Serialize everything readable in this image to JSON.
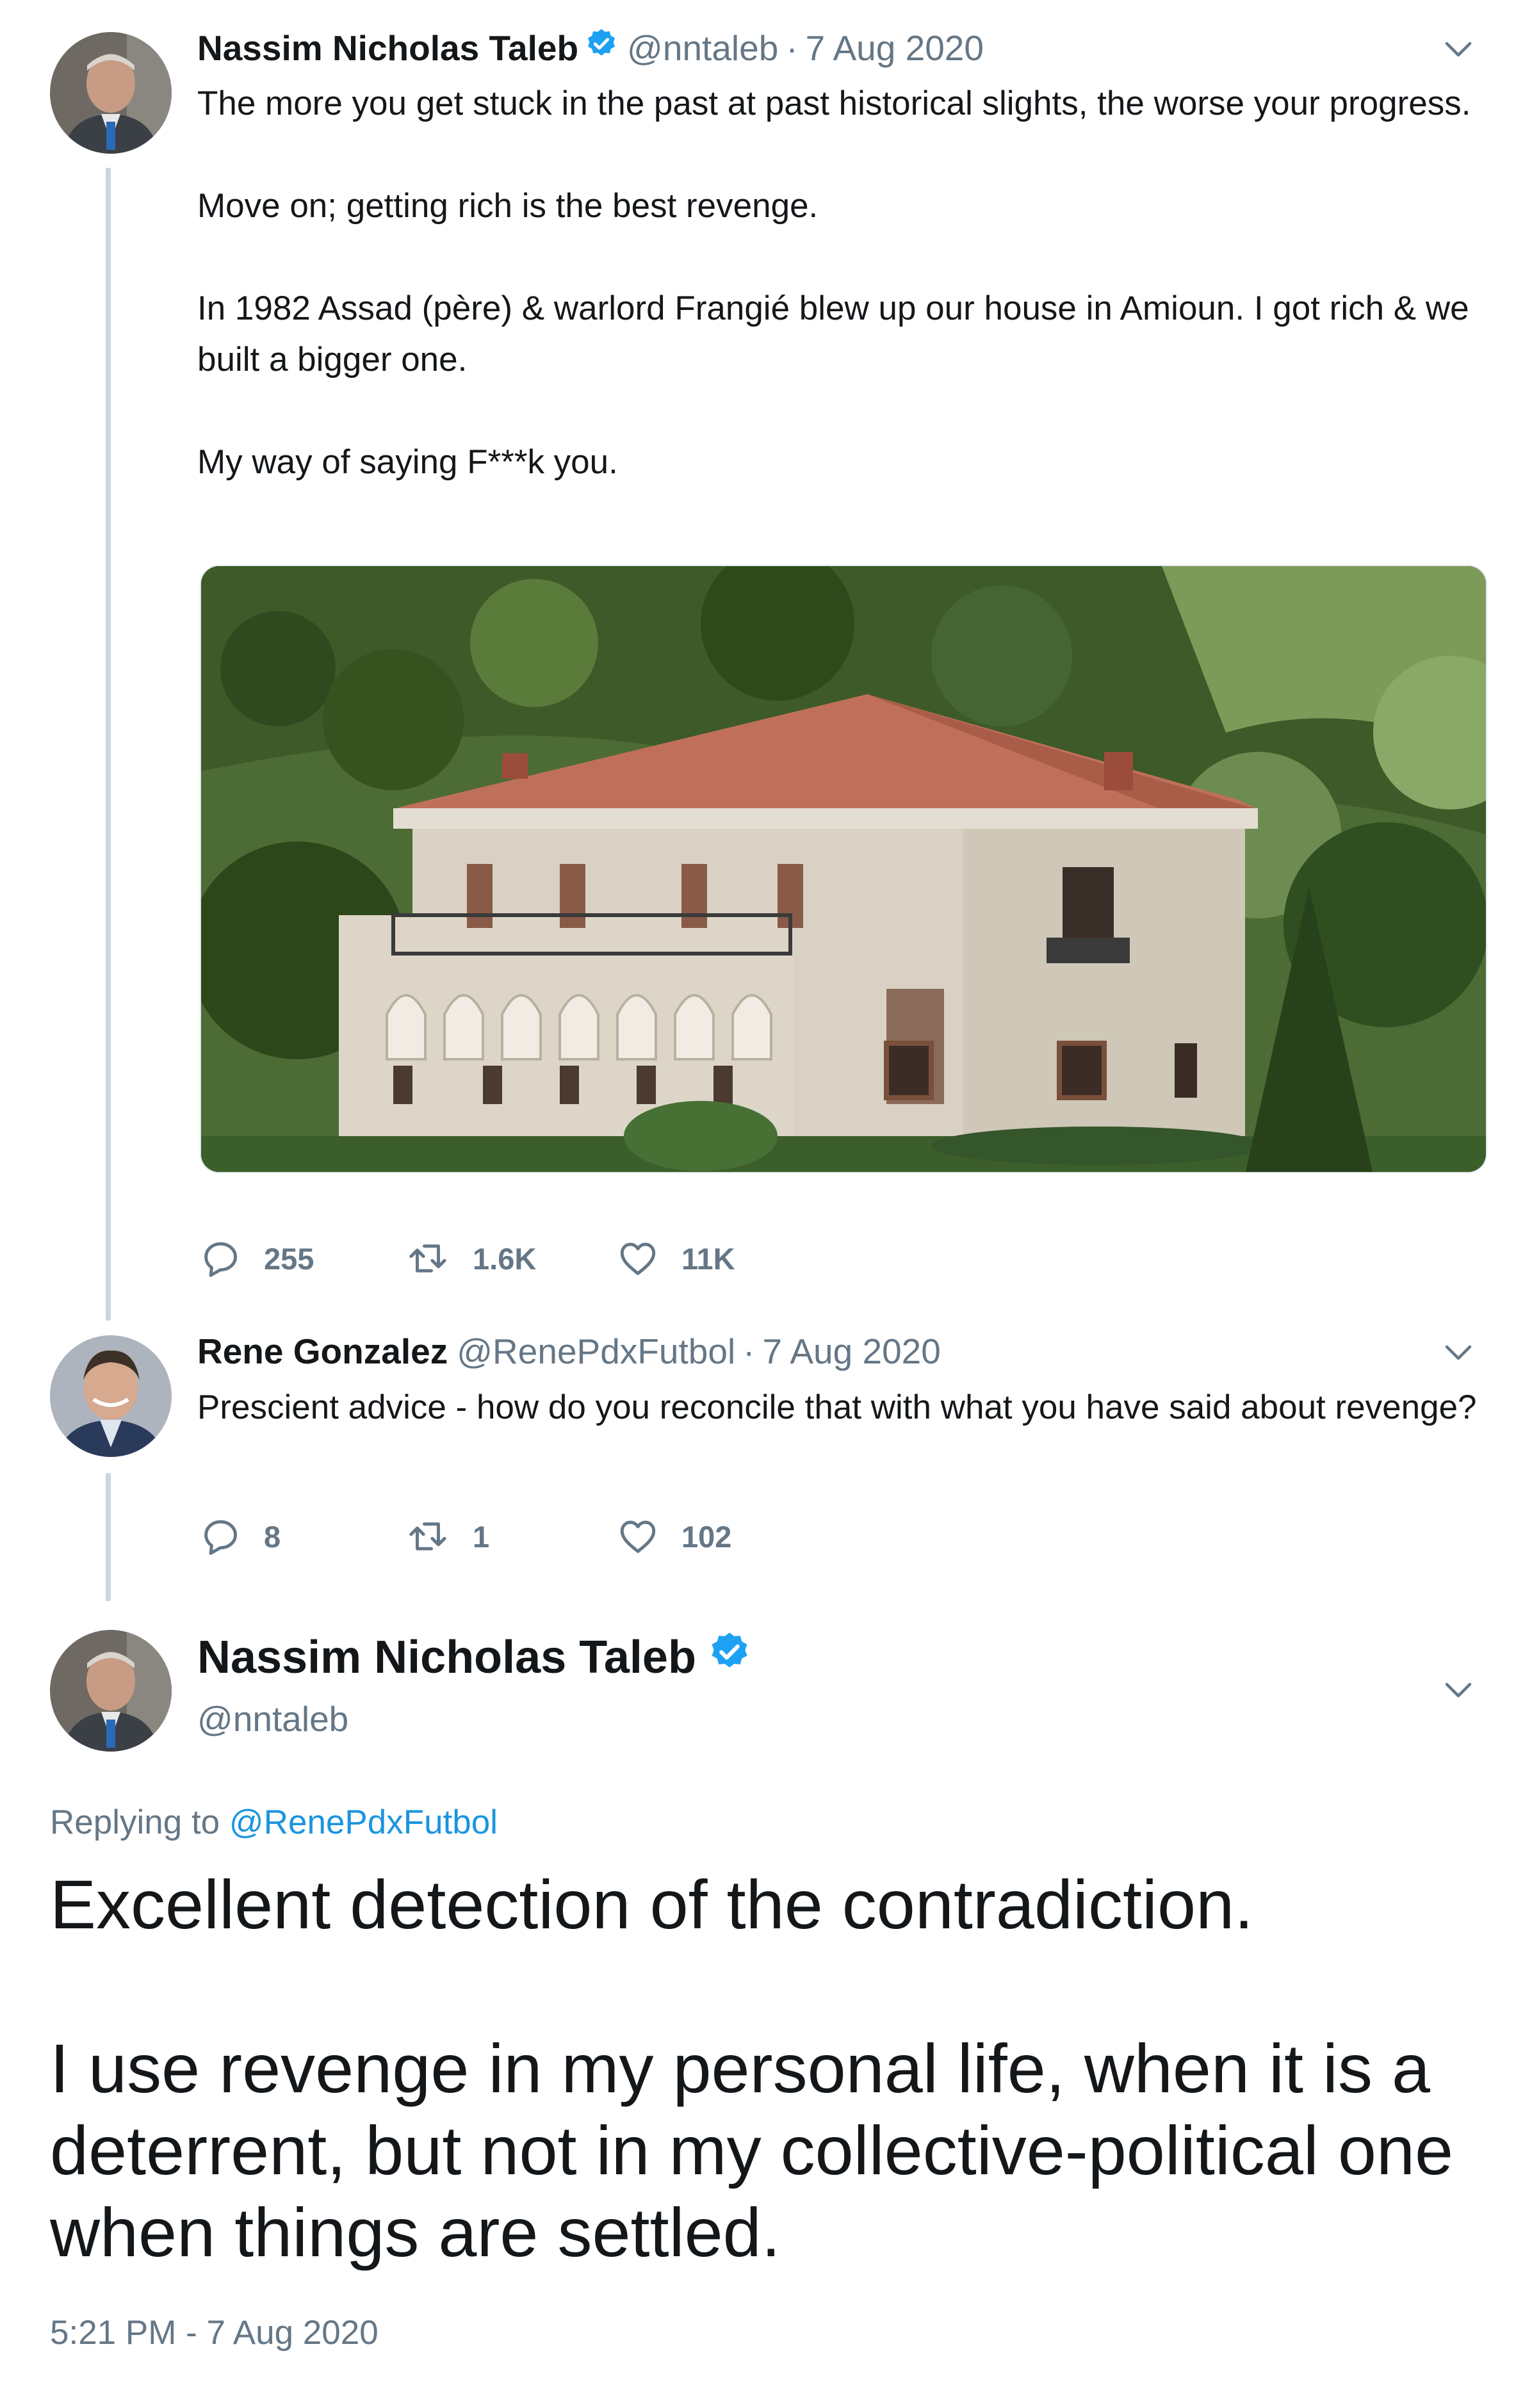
{
  "colors": {
    "name": "#14171a",
    "secondary": "#657786",
    "link": "#1b95e0",
    "verified": "#1da1f2",
    "thread_line": "#ccd6dd"
  },
  "tweet1": {
    "name": "Nassim Nicholas Taleb",
    "handle": "@nntaleb",
    "separator": "·",
    "date": "7 Aug 2020",
    "paragraphs": [
      "The more you get stuck in the past at past historical slights, the worse your progress.",
      "Move on; getting rich is the best revenge.",
      "In 1982 Assad (père) & warlord Frangié blew up our house in Amioun. I got rich & we built a bigger one.",
      "My way of saying F***k you."
    ],
    "replies": "255",
    "retweets": "1.6K",
    "likes": "11K"
  },
  "tweet2": {
    "name": "Rene Gonzalez",
    "handle": "@RenePdxFutbol",
    "separator": "·",
    "date": "7 Aug 2020",
    "text": "Prescient advice - how do you reconcile that with what you have said about revenge?",
    "replies": "8",
    "retweets": "1",
    "likes": "102"
  },
  "tweet3": {
    "name": "Nassim Nicholas Taleb",
    "handle": "@nntaleb",
    "replying_prefix": "Replying to ",
    "replying_to": "@RenePdxFutbol",
    "paragraphs": [
      "Excellent detection of the contradiction.",
      "I use revenge in my personal life, when it is a deterrent, but not in my collective-political one when things are settled."
    ],
    "timestamp": "5:21 PM - 7 Aug 2020"
  },
  "icons": {
    "verified": "verified-badge-icon",
    "more": "chevron-down-icon",
    "reply": "reply-bubble-icon",
    "retweet": "retweet-icon",
    "like": "heart-icon"
  }
}
